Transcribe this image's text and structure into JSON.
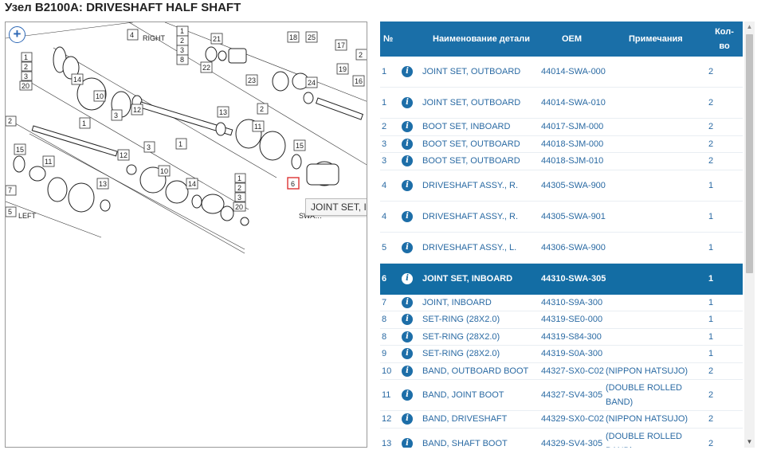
{
  "page_title": "Узел B2100A: DRIVESHAFT HALF SHAFT",
  "diagram": {
    "zoom_label": "+",
    "tooltip": "JOINT SET, INBOARD",
    "labels": {
      "right": "RIGHT",
      "left": "LEFT"
    },
    "code_text": "SWA…"
  },
  "table": {
    "headers": {
      "no": "№",
      "name": "Наименование детали",
      "oem": "OEM",
      "note": "Примечания",
      "qty": "Кол-во"
    },
    "rows": [
      {
        "no": "1",
        "name": "JOINT SET, OUTBOARD",
        "oem": "44014-SWA-000",
        "note": "",
        "qty": "2",
        "selected": false
      },
      {
        "no": "1",
        "name": "JOINT SET, OUTBOARD",
        "oem": "44014-SWA-010",
        "note": "",
        "qty": "2",
        "selected": false
      },
      {
        "no": "2",
        "name": "BOOT SET, INBOARD",
        "oem": "44017-SJM-000",
        "note": "",
        "qty": "2",
        "selected": false
      },
      {
        "no": "3",
        "name": "BOOT SET, OUTBOARD",
        "oem": "44018-SJM-000",
        "note": "",
        "qty": "2",
        "selected": false
      },
      {
        "no": "3",
        "name": "BOOT SET, OUTBOARD",
        "oem": "44018-SJM-010",
        "note": "",
        "qty": "2",
        "selected": false
      },
      {
        "no": "4",
        "name": "DRIVESHAFT ASSY., R.",
        "oem": "44305-SWA-900",
        "note": "",
        "qty": "1",
        "selected": false
      },
      {
        "no": "4",
        "name": "DRIVESHAFT ASSY., R.",
        "oem": "44305-SWA-901",
        "note": "",
        "qty": "1",
        "selected": false
      },
      {
        "no": "5",
        "name": "DRIVESHAFT ASSY., L.",
        "oem": "44306-SWA-900",
        "note": "",
        "qty": "1",
        "selected": false
      },
      {
        "no": "6",
        "name": "JOINT SET, INBOARD",
        "oem": "44310-SWA-305",
        "note": "",
        "qty": "1",
        "selected": true
      },
      {
        "no": "7",
        "name": "JOINT, INBOARD",
        "oem": "44310-S9A-300",
        "note": "",
        "qty": "1",
        "selected": false
      },
      {
        "no": "8",
        "name": "SET-RING (28X2.0)",
        "oem": "44319-SE0-000",
        "note": "",
        "qty": "1",
        "selected": false
      },
      {
        "no": "8",
        "name": "SET-RING (28X2.0)",
        "oem": "44319-S84-300",
        "note": "",
        "qty": "1",
        "selected": false
      },
      {
        "no": "9",
        "name": "SET-RING (28X2.0)",
        "oem": "44319-S0A-300",
        "note": "",
        "qty": "1",
        "selected": false
      },
      {
        "no": "10",
        "name": "BAND, OUTBOARD BOOT",
        "oem": "44327-SX0-C02",
        "note": "(NIPPON HATSUJO)",
        "qty": "2",
        "selected": false
      },
      {
        "no": "11",
        "name": "BAND, JOINT BOOT",
        "oem": "44327-SV4-305",
        "note": "(DOUBLE ROLLED BAND)",
        "qty": "2",
        "selected": false
      },
      {
        "no": "12",
        "name": "BAND, DRIVESHAFT",
        "oem": "44329-SX0-C02",
        "note": "(NIPPON HATSUJO)",
        "qty": "2",
        "selected": false
      },
      {
        "no": "13",
        "name": "BAND, SHAFT BOOT",
        "oem": "44329-SV4-305",
        "note": "(DOUBLE ROLLED BAND)",
        "qty": "2",
        "selected": false
      }
    ]
  },
  "scrollbar": {
    "up": "▲",
    "down": "▼"
  }
}
